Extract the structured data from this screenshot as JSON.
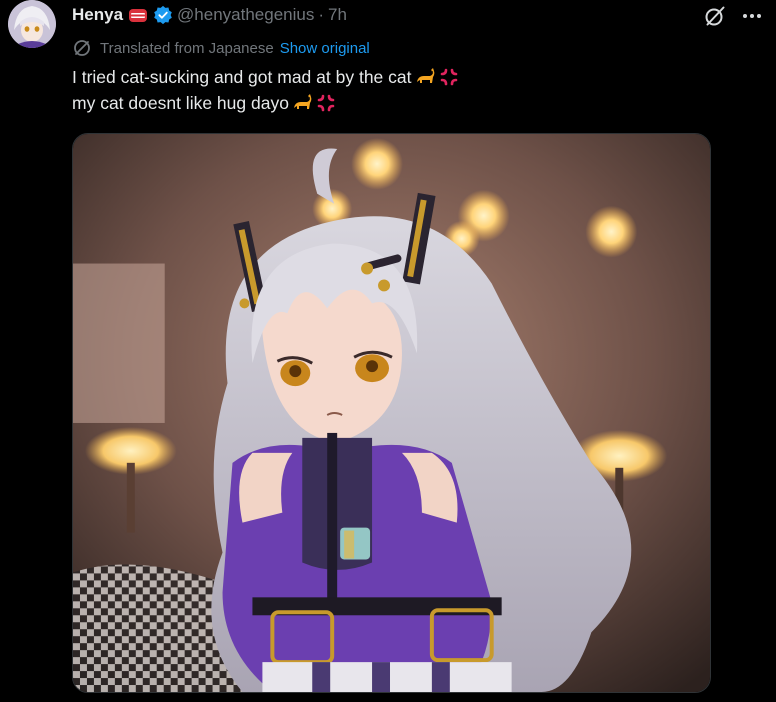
{
  "author": {
    "display_name": "Henya",
    "badge_icon": "red-flag-badge-icon",
    "verified_icon": "verified-check-icon",
    "handle": "@henyathegenius",
    "separator": "·",
    "timestamp": "7h",
    "avatar_icon": "avatar"
  },
  "translation": {
    "icon": "translate-globe-icon",
    "label": "Translated from Japanese",
    "action": "Show original"
  },
  "tweet": {
    "line1": "I tried cat-sucking and got mad at by the cat",
    "line2": "my cat doesnt like hug dayo",
    "emojis": [
      "cat-emoji",
      "anger-symbol-emoji"
    ]
  },
  "actions": {
    "grok_icon": "grok-icon",
    "more_icon": "more-icon"
  },
  "colors": {
    "background": "#000000",
    "text": "#e7e9ea",
    "muted": "#71767b",
    "link": "#1d9bf0",
    "verified": "#1d9bf0",
    "border": "#2f3336"
  },
  "media": {
    "type": "image",
    "subject": "anime-girl-illustration"
  }
}
